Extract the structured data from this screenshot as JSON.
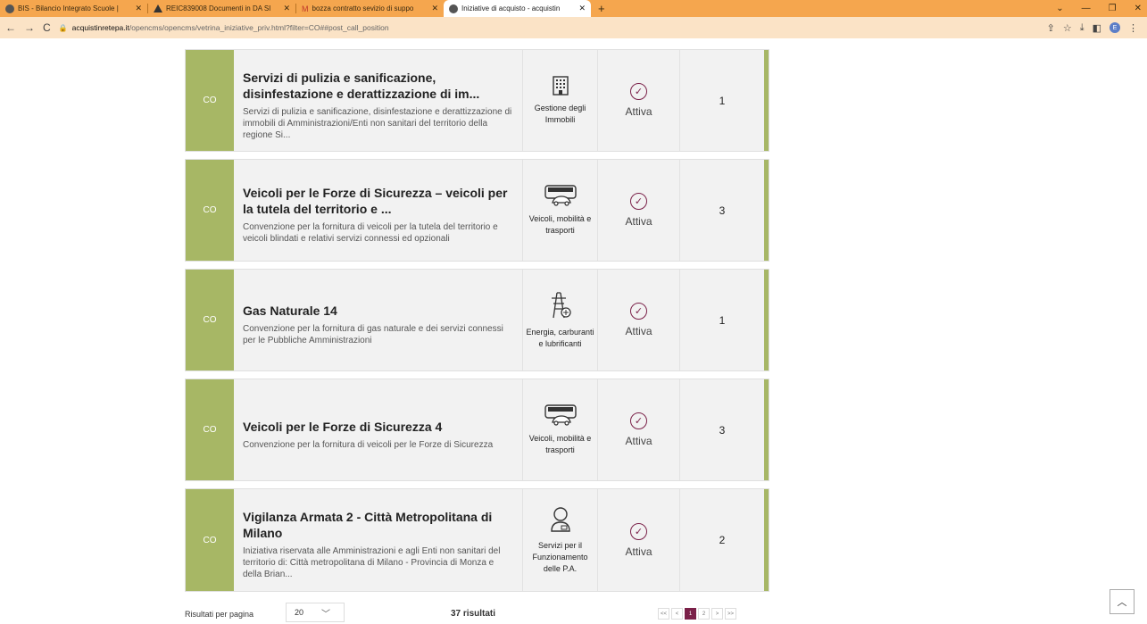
{
  "browser": {
    "tabs": [
      {
        "label": "BIS - Bilancio Integrato Scuole |",
        "active": false
      },
      {
        "label": "REIC839008 Documenti in DA SI",
        "active": false
      },
      {
        "label": "bozza contratto sevizio di suppo",
        "active": false
      },
      {
        "label": "Iniziative di acquisto - acquistin",
        "active": true
      }
    ],
    "new_tab": "+",
    "url_host": "acquistinretepa.it",
    "url_path": "/opencms/opencms/vetrina_iniziative_priv.html?filter=CO##post_call_position",
    "profile_initial": "E"
  },
  "cards": [
    {
      "badge": "CO",
      "title": "Servizi di pulizia e sanificazione, disinfestazione e derattizzazione di im...",
      "desc": "Servizi di pulizia e sanificazione, disinfestazione e derattizzazione di immobili di Amministrazioni/Enti non sanitari del territorio della regione Si...",
      "category": "Gestione degli Immobili",
      "icon": "building-icon",
      "status": "Attiva",
      "lots": "1"
    },
    {
      "badge": "CO",
      "title": "Veicoli per le Forze di Sicurezza – veicoli per la tutela del territorio e ...",
      "desc": "Convenzione per la fornitura di veicoli per la tutela del territorio e veicoli blindati e relativi servizi connessi ed opzionali",
      "category": "Veicoli, mobilità e trasporti",
      "icon": "vehicles-icon",
      "status": "Attiva",
      "lots": "3"
    },
    {
      "badge": "CO",
      "title": "Gas Naturale 14",
      "desc": "Convenzione per la fornitura di gas naturale e dei servizi connessi per le Pubbliche Amministrazioni",
      "category": "Energia, carburanti e lubrificanti",
      "icon": "energy-pylon-icon",
      "status": "Attiva",
      "lots": "1"
    },
    {
      "badge": "CO",
      "title": "Veicoli per le Forze di Sicurezza 4",
      "desc": "Convenzione per la fornitura di veicoli per le Forze di Sicurezza",
      "category": "Veicoli, mobilità e trasporti",
      "icon": "vehicles-icon",
      "status": "Attiva",
      "lots": "3"
    },
    {
      "badge": "CO",
      "title": "Vigilanza Armata 2 - Città Metropolitana di Milano",
      "desc": "Iniziativa riservata alle Amministrazioni e agli Enti non sanitari del territorio di: Città metropolitana di Milano - Provincia di Monza e della Brian...",
      "category": "Servizi per il Funzionamento delle P.A.",
      "icon": "person-service-icon",
      "status": "Attiva",
      "lots": "2"
    }
  ],
  "footer": {
    "per_page_label": "Risultati per pagina",
    "per_page_value": "20",
    "results": "37 risultati",
    "pager": [
      "<<",
      "<",
      "1",
      "2",
      ">",
      ">>"
    ],
    "current_page": "1"
  }
}
